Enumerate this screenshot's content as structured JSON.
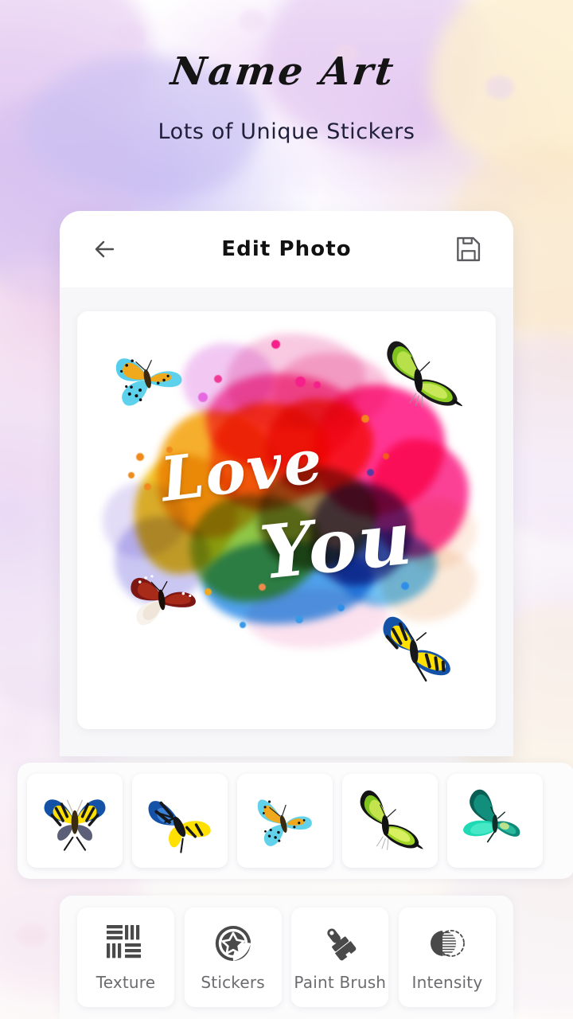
{
  "header": {
    "title": "Name Art",
    "subtitle": "Lots of Unique Stickers"
  },
  "appbar": {
    "title": "Edit Photo",
    "back_icon": "arrow-left-icon",
    "save_icon": "floppy-disk-save-icon"
  },
  "canvas": {
    "art_line_1": "Love",
    "art_line_2": "You",
    "background_color": "#ffffff",
    "splash_colors": [
      "#f9c9e4",
      "#ff2d8f",
      "#f9a01b",
      "#f4511e",
      "#8bc34a",
      "#2196f3",
      "#6a4ea3",
      "#b39ddb"
    ],
    "placed_stickers": [
      {
        "name": "cyan-yellow-butterfly",
        "position": "top-left"
      },
      {
        "name": "green-yellow-butterfly",
        "position": "top-right"
      },
      {
        "name": "red-brown-butterfly",
        "position": "bottom-left"
      },
      {
        "name": "yellow-blue-butterfly",
        "position": "bottom-right"
      }
    ]
  },
  "sticker_strip": {
    "items": [
      {
        "name": "yellow-blue-butterfly-open",
        "colors": [
          "#1565c0",
          "#ffe100",
          "#2b2b2b"
        ]
      },
      {
        "name": "yellow-blue-butterfly-side",
        "colors": [
          "#1565c0",
          "#ffe100",
          "#111111"
        ]
      },
      {
        "name": "cyan-yellow-spotted-butterfly",
        "colors": [
          "#4ec9e8",
          "#f5a623",
          "#111111"
        ]
      },
      {
        "name": "green-yellow-butterfly",
        "colors": [
          "#8bc34a",
          "#cddc39",
          "#111111"
        ]
      },
      {
        "name": "teal-butterfly",
        "colors": [
          "#0f9b8e",
          "#1de9b6",
          "#0b5f55"
        ]
      }
    ]
  },
  "toolbar": {
    "tools": [
      {
        "label": "Texture",
        "icon": "texture-weave-icon"
      },
      {
        "label": "Stickers",
        "icon": "sticker-star-icon"
      },
      {
        "label": "Paint Brush",
        "icon": "paint-brush-icon"
      },
      {
        "label": "Intensity",
        "icon": "intensity-contrast-icon"
      }
    ]
  },
  "colors": {
    "page_background": "#fdfcff",
    "card_background": "#ffffff",
    "icon_dark": "#4a4a4a",
    "label_gray": "#6c6c70",
    "title_black": "#141414"
  }
}
